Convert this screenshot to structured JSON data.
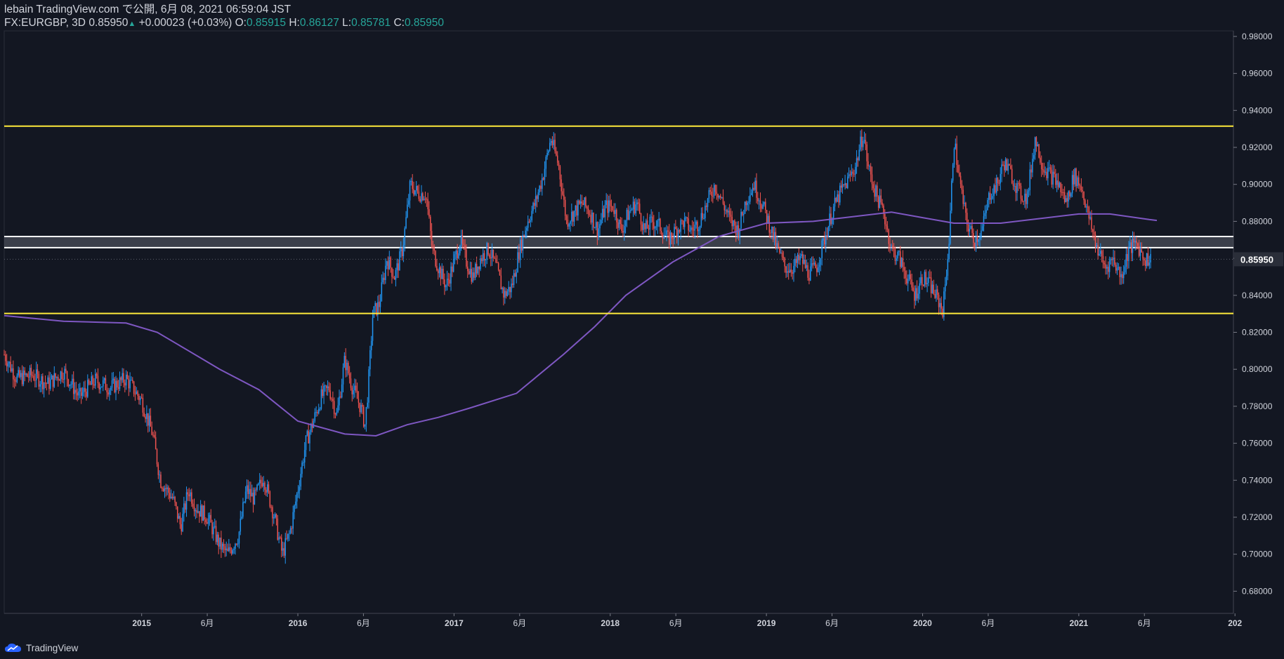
{
  "header": {
    "line1": "lebain TradingView.com で公開, 6月 08, 2021 06:59:04 JST",
    "symbol": "FX:EURGBP, 3D",
    "last": "0.85950",
    "change_arrow": "▲",
    "change": "+0.00023 (+0.03%)",
    "o_label": "O:",
    "o": "0.85915",
    "h_label": "H:",
    "h": "0.86127",
    "l_label": "L:",
    "l": "0.85781",
    "c_label": "C:",
    "c": "0.85950"
  },
  "footer": {
    "brand": "TradingView",
    "icon": "tradingview-cloud-icon"
  },
  "colors": {
    "background": "#131722",
    "up": "#2196f3",
    "down": "#ef5350",
    "ma": "#7e57c2",
    "level": "#ffeb3b",
    "zone": "#ffffff",
    "text": "#d1d4dc",
    "price_tag": "#2a2e39"
  },
  "chart_data": {
    "type": "candlestick",
    "symbol": "FX:EURGBP",
    "timeframe": "3D",
    "x_range": [
      2014.12,
      2021.99
    ],
    "ylim": [
      0.668,
      0.983
    ],
    "y_ticks": [
      "0.68000",
      "0.70000",
      "0.72000",
      "0.74000",
      "0.76000",
      "0.78000",
      "0.80000",
      "0.82000",
      "0.84000",
      "0.86000",
      "0.88000",
      "0.90000",
      "0.92000",
      "0.94000",
      "0.96000",
      "0.98000"
    ],
    "x_ticks": [
      {
        "t": 2015.0,
        "label": "2015",
        "bold": true
      },
      {
        "t": 2015.42,
        "label": "6月",
        "bold": false
      },
      {
        "t": 2016.0,
        "label": "2016",
        "bold": true
      },
      {
        "t": 2016.42,
        "label": "6月",
        "bold": false
      },
      {
        "t": 2017.0,
        "label": "2017",
        "bold": true
      },
      {
        "t": 2017.42,
        "label": "6月",
        "bold": false
      },
      {
        "t": 2018.0,
        "label": "2018",
        "bold": true
      },
      {
        "t": 2018.42,
        "label": "6月",
        "bold": false
      },
      {
        "t": 2019.0,
        "label": "2019",
        "bold": true
      },
      {
        "t": 2019.42,
        "label": "6月",
        "bold": false
      },
      {
        "t": 2020.0,
        "label": "2020",
        "bold": true
      },
      {
        "t": 2020.42,
        "label": "6月",
        "bold": false
      },
      {
        "t": 2021.0,
        "label": "2021",
        "bold": true
      },
      {
        "t": 2021.42,
        "label": "6月",
        "bold": false
      },
      {
        "t": 2022.0,
        "label": "202",
        "bold": true
      }
    ],
    "price_series": [
      [
        2014.12,
        0.808
      ],
      [
        2014.2,
        0.795
      ],
      [
        2014.3,
        0.797
      ],
      [
        2014.4,
        0.792
      ],
      [
        2014.5,
        0.799
      ],
      [
        2014.6,
        0.785
      ],
      [
        2014.7,
        0.794
      ],
      [
        2014.8,
        0.79
      ],
      [
        2014.9,
        0.795
      ],
      [
        2015.0,
        0.783
      ],
      [
        2015.07,
        0.765
      ],
      [
        2015.12,
        0.74
      ],
      [
        2015.2,
        0.73
      ],
      [
        2015.25,
        0.715
      ],
      [
        2015.3,
        0.735
      ],
      [
        2015.35,
        0.725
      ],
      [
        2015.42,
        0.72
      ],
      [
        2015.5,
        0.705
      ],
      [
        2015.55,
        0.7
      ],
      [
        2015.62,
        0.71
      ],
      [
        2015.67,
        0.735
      ],
      [
        2015.72,
        0.73
      ],
      [
        2015.78,
        0.742
      ],
      [
        2015.85,
        0.72
      ],
      [
        2015.9,
        0.7
      ],
      [
        2015.95,
        0.712
      ],
      [
        2016.0,
        0.735
      ],
      [
        2016.05,
        0.76
      ],
      [
        2016.1,
        0.772
      ],
      [
        2016.15,
        0.785
      ],
      [
        2016.2,
        0.79
      ],
      [
        2016.25,
        0.775
      ],
      [
        2016.3,
        0.805
      ],
      [
        2016.35,
        0.79
      ],
      [
        2016.4,
        0.78
      ],
      [
        2016.43,
        0.77
      ],
      [
        2016.45,
        0.79
      ],
      [
        2016.48,
        0.83
      ],
      [
        2016.52,
        0.835
      ],
      [
        2016.57,
        0.86
      ],
      [
        2016.62,
        0.85
      ],
      [
        2016.67,
        0.865
      ],
      [
        2016.72,
        0.9
      ],
      [
        2016.77,
        0.895
      ],
      [
        2016.82,
        0.895
      ],
      [
        2016.86,
        0.865
      ],
      [
        2016.9,
        0.855
      ],
      [
        2016.95,
        0.845
      ],
      [
        2017.0,
        0.858
      ],
      [
        2017.04,
        0.87
      ],
      [
        2017.08,
        0.858
      ],
      [
        2017.12,
        0.85
      ],
      [
        2017.17,
        0.86
      ],
      [
        2017.22,
        0.865
      ],
      [
        2017.27,
        0.855
      ],
      [
        2017.32,
        0.84
      ],
      [
        2017.37,
        0.845
      ],
      [
        2017.42,
        0.865
      ],
      [
        2017.47,
        0.88
      ],
      [
        2017.52,
        0.89
      ],
      [
        2017.57,
        0.905
      ],
      [
        2017.62,
        0.925
      ],
      [
        2017.67,
        0.91
      ],
      [
        2017.72,
        0.88
      ],
      [
        2017.77,
        0.885
      ],
      [
        2017.82,
        0.89
      ],
      [
        2017.87,
        0.885
      ],
      [
        2017.92,
        0.875
      ],
      [
        2017.97,
        0.888
      ],
      [
        2018.02,
        0.888
      ],
      [
        2018.07,
        0.875
      ],
      [
        2018.12,
        0.885
      ],
      [
        2018.17,
        0.89
      ],
      [
        2018.22,
        0.875
      ],
      [
        2018.27,
        0.88
      ],
      [
        2018.32,
        0.877
      ],
      [
        2018.37,
        0.87
      ],
      [
        2018.42,
        0.875
      ],
      [
        2018.47,
        0.88
      ],
      [
        2018.52,
        0.875
      ],
      [
        2018.57,
        0.88
      ],
      [
        2018.62,
        0.89
      ],
      [
        2018.67,
        0.9
      ],
      [
        2018.72,
        0.89
      ],
      [
        2018.77,
        0.88
      ],
      [
        2018.82,
        0.875
      ],
      [
        2018.87,
        0.892
      ],
      [
        2018.92,
        0.9
      ],
      [
        2018.97,
        0.89
      ],
      [
        2019.02,
        0.878
      ],
      [
        2019.07,
        0.865
      ],
      [
        2019.12,
        0.855
      ],
      [
        2019.17,
        0.855
      ],
      [
        2019.22,
        0.86
      ],
      [
        2019.27,
        0.852
      ],
      [
        2019.32,
        0.855
      ],
      [
        2019.37,
        0.87
      ],
      [
        2019.42,
        0.885
      ],
      [
        2019.47,
        0.895
      ],
      [
        2019.52,
        0.902
      ],
      [
        2019.57,
        0.91
      ],
      [
        2019.62,
        0.928
      ],
      [
        2019.65,
        0.91
      ],
      [
        2019.7,
        0.895
      ],
      [
        2019.75,
        0.885
      ],
      [
        2019.8,
        0.865
      ],
      [
        2019.85,
        0.86
      ],
      [
        2019.9,
        0.85
      ],
      [
        2019.95,
        0.84
      ],
      [
        2020.0,
        0.85
      ],
      [
        2020.05,
        0.845
      ],
      [
        2020.1,
        0.837
      ],
      [
        2020.13,
        0.832
      ],
      [
        2020.17,
        0.87
      ],
      [
        2020.2,
        0.925
      ],
      [
        2020.24,
        0.9
      ],
      [
        2020.28,
        0.88
      ],
      [
        2020.33,
        0.87
      ],
      [
        2020.38,
        0.875
      ],
      [
        2020.43,
        0.895
      ],
      [
        2020.48,
        0.9
      ],
      [
        2020.52,
        0.912
      ],
      [
        2020.57,
        0.905
      ],
      [
        2020.62,
        0.895
      ],
      [
        2020.67,
        0.893
      ],
      [
        2020.72,
        0.925
      ],
      [
        2020.77,
        0.91
      ],
      [
        2020.82,
        0.905
      ],
      [
        2020.87,
        0.9
      ],
      [
        2020.92,
        0.89
      ],
      [
        2020.97,
        0.905
      ],
      [
        2021.02,
        0.898
      ],
      [
        2021.07,
        0.88
      ],
      [
        2021.12,
        0.865
      ],
      [
        2021.17,
        0.855
      ],
      [
        2021.22,
        0.86
      ],
      [
        2021.27,
        0.85
      ],
      [
        2021.32,
        0.865
      ],
      [
        2021.37,
        0.868
      ],
      [
        2021.42,
        0.86
      ],
      [
        2021.46,
        0.8595
      ]
    ],
    "ma_series": [
      [
        2014.12,
        0.829
      ],
      [
        2014.5,
        0.826
      ],
      [
        2014.9,
        0.825
      ],
      [
        2015.1,
        0.82
      ],
      [
        2015.3,
        0.81
      ],
      [
        2015.5,
        0.8
      ],
      [
        2015.75,
        0.789
      ],
      [
        2016.0,
        0.772
      ],
      [
        2016.3,
        0.765
      ],
      [
        2016.5,
        0.764
      ],
      [
        2016.7,
        0.77
      ],
      [
        2016.9,
        0.774
      ],
      [
        2017.1,
        0.779
      ],
      [
        2017.4,
        0.787
      ],
      [
        2017.7,
        0.808
      ],
      [
        2017.9,
        0.823
      ],
      [
        2018.1,
        0.84
      ],
      [
        2018.4,
        0.858
      ],
      [
        2018.7,
        0.872
      ],
      [
        2019.0,
        0.879
      ],
      [
        2019.3,
        0.88
      ],
      [
        2019.6,
        0.883
      ],
      [
        2019.8,
        0.885
      ],
      [
        2020.0,
        0.882
      ],
      [
        2020.2,
        0.879
      ],
      [
        2020.5,
        0.879
      ],
      [
        2020.8,
        0.882
      ],
      [
        2021.0,
        0.884
      ],
      [
        2021.2,
        0.884
      ],
      [
        2021.45,
        0.881
      ],
      [
        2021.5,
        0.8805
      ]
    ],
    "levels": [
      {
        "name": "resistance",
        "value": 0.9315,
        "color": "#ffeb3b"
      },
      {
        "name": "support",
        "value": 0.8302,
        "color": "#ffeb3b"
      }
    ],
    "zone": {
      "upper": 0.8718,
      "lower": 0.8658
    },
    "last_price": {
      "value": 0.8595,
      "label": "0.85950"
    }
  }
}
